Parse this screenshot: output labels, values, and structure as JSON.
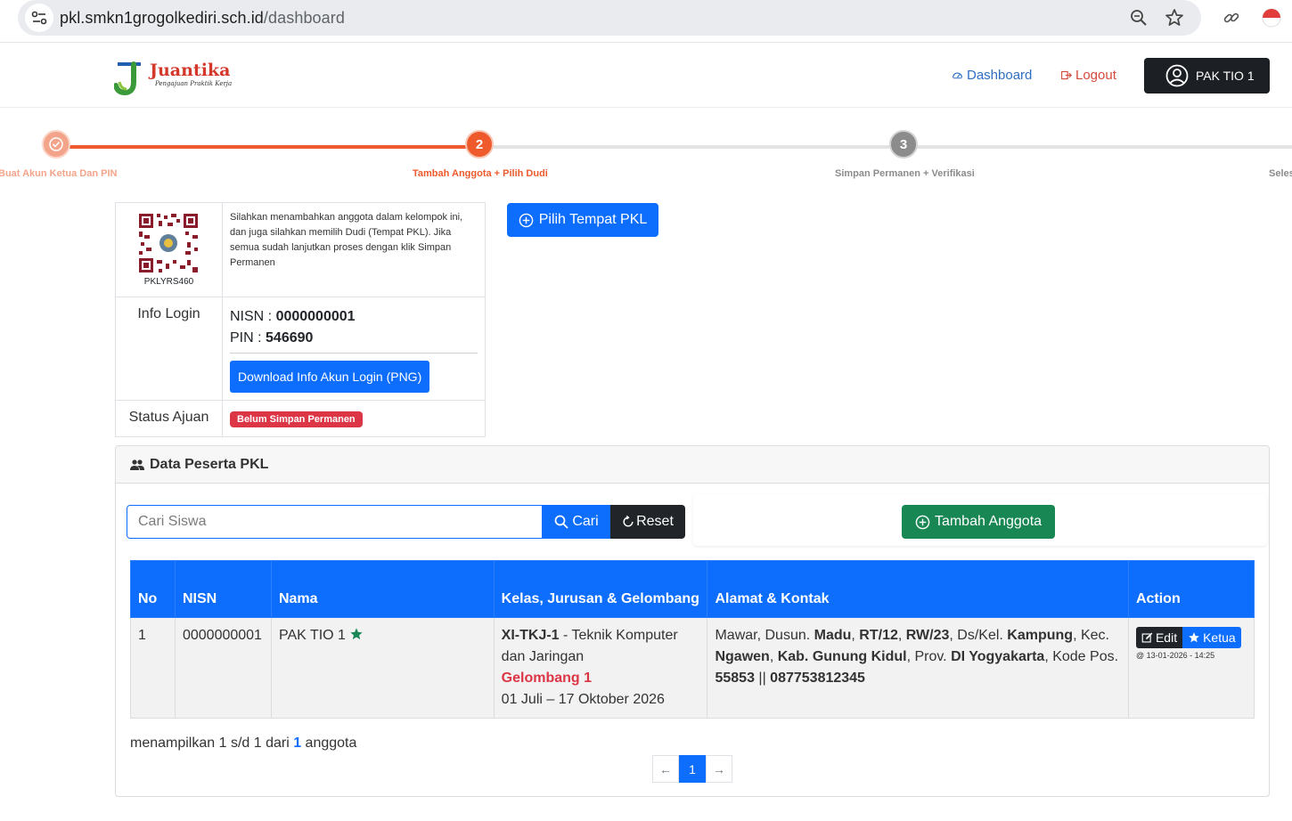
{
  "browser": {
    "url_domain": "pkl.smkn1grogolkediri.sch.id",
    "url_path": "/dashboard"
  },
  "header": {
    "logo_title": "Juantika",
    "logo_tagline": "Pengajuan Praktik Kerja",
    "nav_dashboard": "Dashboard",
    "nav_logout": "Logout",
    "user_name": "PAK TIO 1"
  },
  "stepper": {
    "steps": [
      {
        "label": "Buat Akun Ketua Dan PIN",
        "state": "done"
      },
      {
        "label": "Tambah Anggota + Pilih Dudi",
        "number": "2",
        "state": "active"
      },
      {
        "label": "Simpan Permanen + Verifikasi",
        "number": "3",
        "state": "pending"
      },
      {
        "label": "Seles",
        "state": "pending"
      }
    ]
  },
  "info": {
    "qr_code_id": "PKLYRS460",
    "description": "Silahkan menambahkan anggota dalam kelompok ini, dan juga silahkan memilih Dudi (Tempat PKL). Jika semua sudah lanjutkan proses dengan klik Simpan Permanen",
    "login_label": "Info Login",
    "nisn_label": "NISN : ",
    "nisn_value": "0000000001",
    "pin_label": "PIN : ",
    "pin_value": "546690",
    "download_button": "Download Info Akun Login (PNG)",
    "status_label": "Status Ajuan",
    "status_value": "Belum Simpan Permanen"
  },
  "pilih_button": "Pilih Tempat PKL",
  "card": {
    "title": "Data Peserta PKL",
    "search_placeholder": "Cari Siswa",
    "cari_button": "Cari",
    "reset_button": "Reset",
    "tambah_button": "Tambah Anggota",
    "columns": [
      "No",
      "NISN",
      "Nama",
      "Kelas, Jurusan & Gelombang",
      "Alamat & Kontak",
      "Action"
    ],
    "rows": [
      {
        "no": "1",
        "nisn": "0000000001",
        "nama": "PAK TIO 1",
        "kelas_code": "XI-TKJ-1",
        "jurusan": " - Teknik Komputer dan Jaringan",
        "gelombang": "Gelombang 1",
        "periode": "01 Juli – 17 Oktober 2026",
        "alamat_parts": {
          "p1": "Mawar, Dusun. ",
          "dusun": "Madu",
          "rt": "RT/12",
          "rw": "RW/23",
          "p2": ", Ds/Kel. ",
          "desa": "Kampung",
          "p3": ", Kec. ",
          "kec": "Ngawen",
          "kab": "Kab. Gunung Kidul",
          "p4": ", Prov. ",
          "prov": "DI Yogyakarta",
          "p5": ", Kode Pos. ",
          "kodepos": "55853",
          "p6": " || ",
          "phone": "087753812345"
        },
        "edit_button": "Edit",
        "ketua_button": "Ketua",
        "timestamp": "@ 13-01-2026 - 14:25"
      }
    ],
    "showing_prefix": "menampilkan 1 s/d 1 dari ",
    "showing_count": "1",
    "showing_suffix": " anggota",
    "pager_prev": "←",
    "pager_current": "1",
    "pager_next": "→"
  },
  "colors": {
    "primary": "#0d6efd",
    "success": "#198754",
    "danger": "#dc3545",
    "stepper_active": "#ee5a2b",
    "stepper_done": "#f4a48a",
    "stepper_pending": "#8c8c8c"
  }
}
